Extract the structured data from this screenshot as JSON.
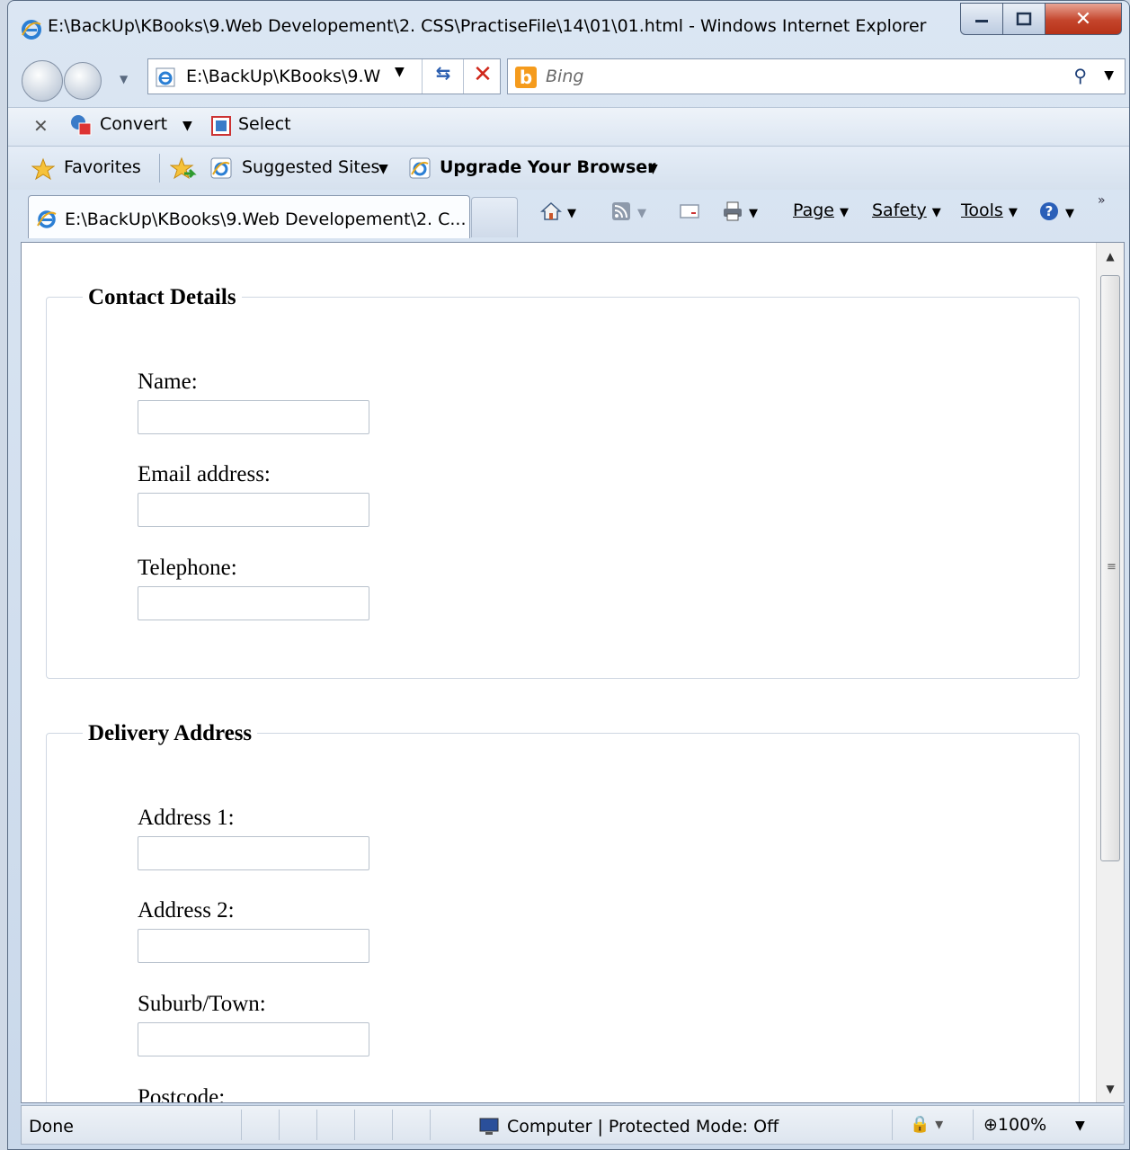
{
  "window": {
    "title": "E:\\BackUp\\KBooks\\9.Web Developement\\2. CSS\\PractiseFile\\14\\01\\01.html - Windows Internet Explorer"
  },
  "address_bar": {
    "url": "E:\\BackUp\\KBooks\\9.W"
  },
  "search_bar": {
    "placeholder": "Bing"
  },
  "addon_bar": {
    "convert_label": "Convert",
    "select_label": "Select"
  },
  "favorites_bar": {
    "favorites_label": "Favorites",
    "suggested_sites_label": "Suggested Sites",
    "upgrade_label": "Upgrade Your Browser"
  },
  "tab": {
    "label": "E:\\BackUp\\KBooks\\9.Web Developement\\2. C..."
  },
  "command_bar": {
    "page_label": "Page",
    "safety_label": "Safety",
    "tools_label": "Tools"
  },
  "form": {
    "contact": {
      "legend": "Contact Details",
      "fields": [
        {
          "label": "Name:",
          "value": ""
        },
        {
          "label": "Email address:",
          "value": ""
        },
        {
          "label": "Telephone:",
          "value": ""
        }
      ]
    },
    "delivery": {
      "legend": "Delivery Address",
      "fields": [
        {
          "label": "Address 1:",
          "value": ""
        },
        {
          "label": "Address 2:",
          "value": ""
        },
        {
          "label": "Suburb/Town:",
          "value": ""
        },
        {
          "label": "Postcode:",
          "value": ""
        }
      ]
    }
  },
  "status_bar": {
    "status": "Done",
    "zone": "Computer | Protected Mode: Off",
    "zoom": "100%"
  },
  "colors": {
    "close_button": "#c4452c",
    "bing_orange": "#f59b1c",
    "stop_red": "#d0281b"
  }
}
